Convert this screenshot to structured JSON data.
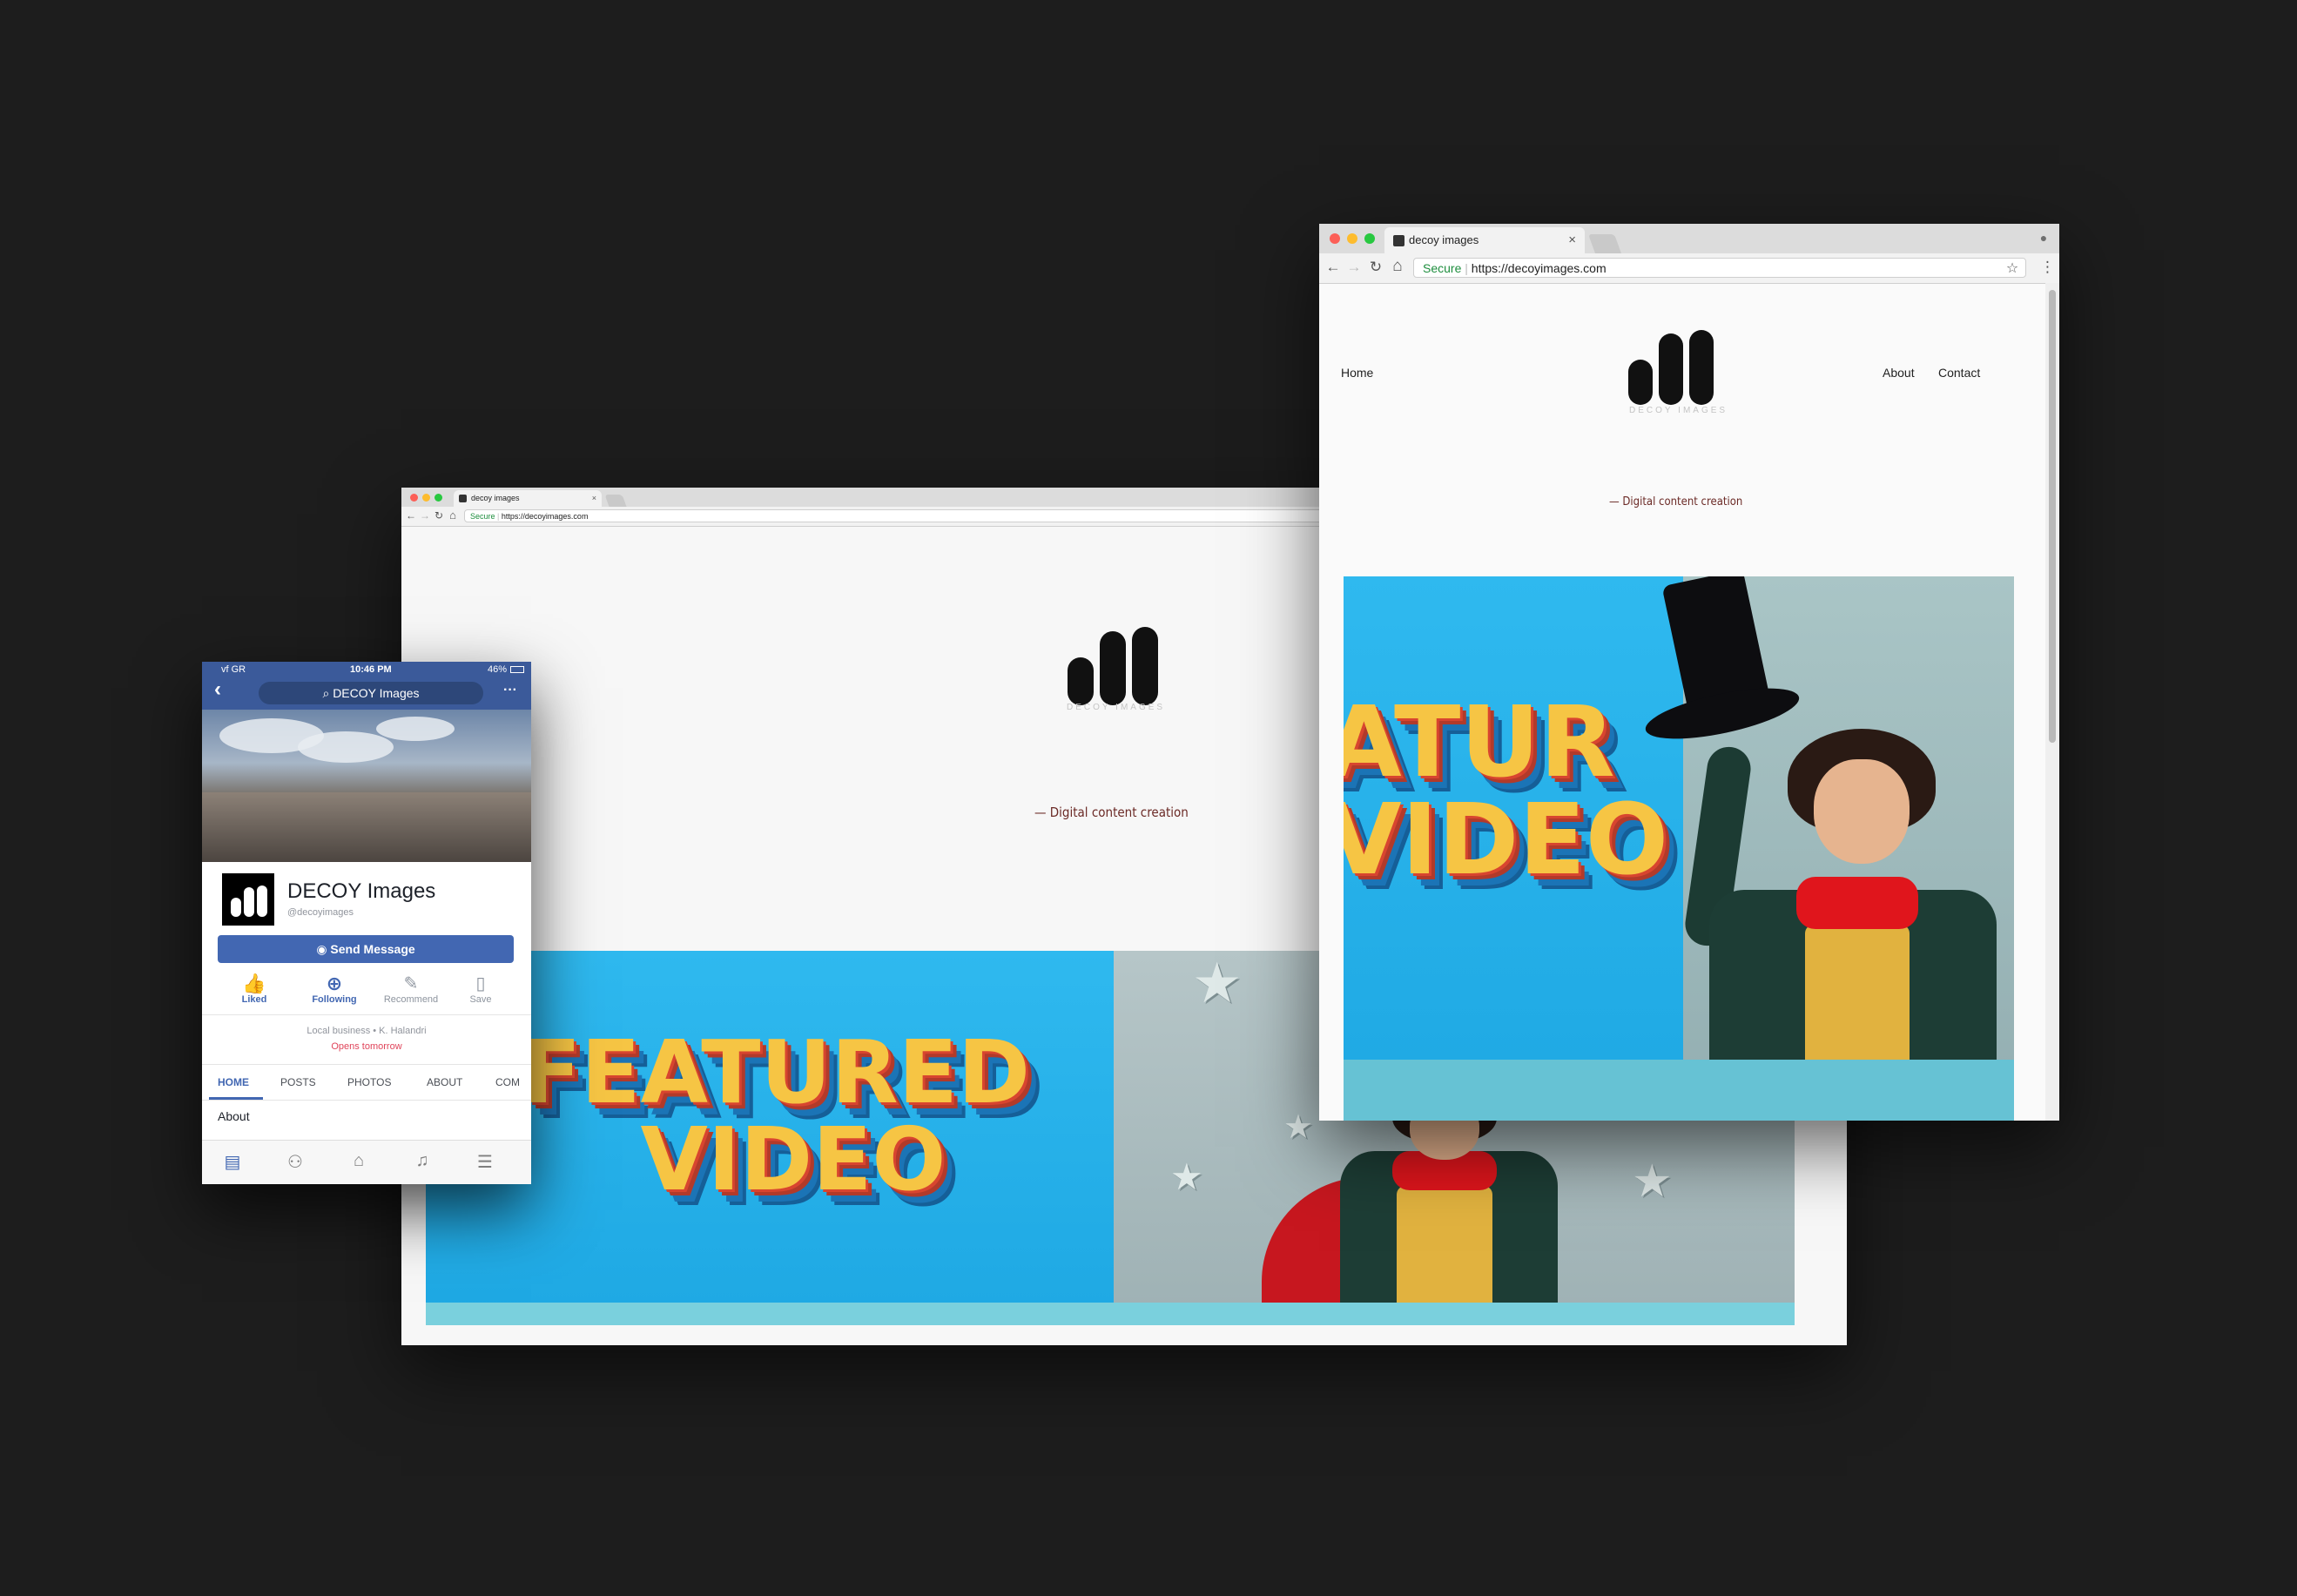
{
  "colors": {
    "background": "#1d1d1d",
    "facebook_blue": "#3b5a9a",
    "button_blue": "#4267b2",
    "tagline": "#6b2a26",
    "secure_green": "#1e8e3e",
    "hero_blue": "#2cb2ea",
    "marquee_yellow": "#f6c544"
  },
  "site": {
    "tab_title": "decoy images",
    "secure_label": "Secure",
    "url": "https://decoyimages.com",
    "logo_subtitle": "DECOY IMAGES",
    "tagline": "— Digital content creation",
    "nav": {
      "home": "Home",
      "about": "About",
      "contact": "Contact"
    },
    "hero": {
      "line1": "FEATURED",
      "line2": "VIDEO",
      "crop_line1": "ATUR",
      "crop_line2": "VIDEO"
    }
  },
  "icons": {
    "back": "←",
    "forward": "→",
    "reload": "↻",
    "home": "⌂",
    "lock": "🔒",
    "star": "☆",
    "menu": "⋮",
    "close": "×",
    "profile": "●"
  },
  "facebook": {
    "status": {
      "carrier": "vf GR",
      "time": "10:46 PM",
      "battery": "46%"
    },
    "search_text": "DECOY Images",
    "more": "···",
    "page_name": "DECOY Images",
    "handle": "@decoyimages",
    "send_message": "Send Message",
    "actions": [
      {
        "label": "Liked",
        "icon": "thumb-icon"
      },
      {
        "label": "Following",
        "icon": "follow-icon"
      },
      {
        "label": "Recommend",
        "icon": "recommend-icon"
      },
      {
        "label": "Save",
        "icon": "bookmark-icon"
      }
    ],
    "category": "Local business • K. Halandri",
    "hours": "Opens tomorrow",
    "tabs": [
      "HOME",
      "POSTS",
      "PHOTOS",
      "ABOUT",
      "COM"
    ],
    "section": "About"
  }
}
